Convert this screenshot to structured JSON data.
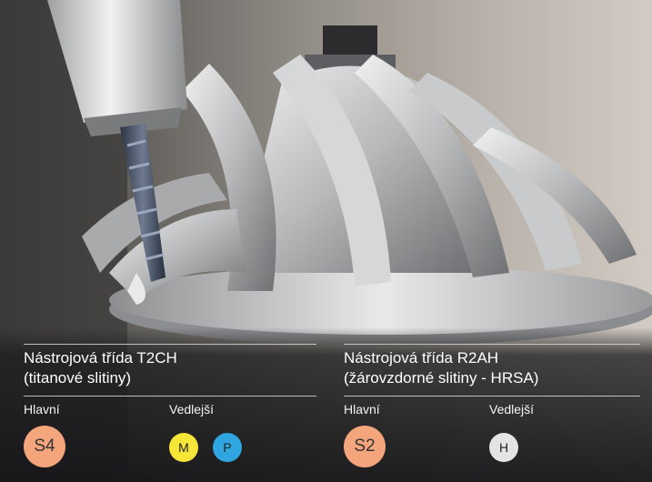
{
  "left_panel": {
    "title": "Nástrojová třída T2CH",
    "subtitle": "(titanové slitiny)",
    "primary_label": "Hlavní",
    "secondary_label": "Vedlejší",
    "primary_badges": [
      {
        "text": "S4",
        "color": "#f4a57c"
      }
    ],
    "secondary_badges": [
      {
        "text": "M",
        "color": "#f6e637"
      },
      {
        "text": "P",
        "color": "#2fa6df"
      }
    ]
  },
  "right_panel": {
    "title": "Nástrojová třída R2AH",
    "subtitle": "(žárovzdorné slitiny - HRSA)",
    "primary_label": "Hlavní",
    "secondary_label": "Vedlejší",
    "primary_badges": [
      {
        "text": "S2",
        "color": "#f4a57c"
      }
    ],
    "secondary_badges": [
      {
        "text": "H",
        "color": "#e4e4e4"
      }
    ]
  },
  "photo": {
    "subject": "end-mill-machining-impeller"
  }
}
